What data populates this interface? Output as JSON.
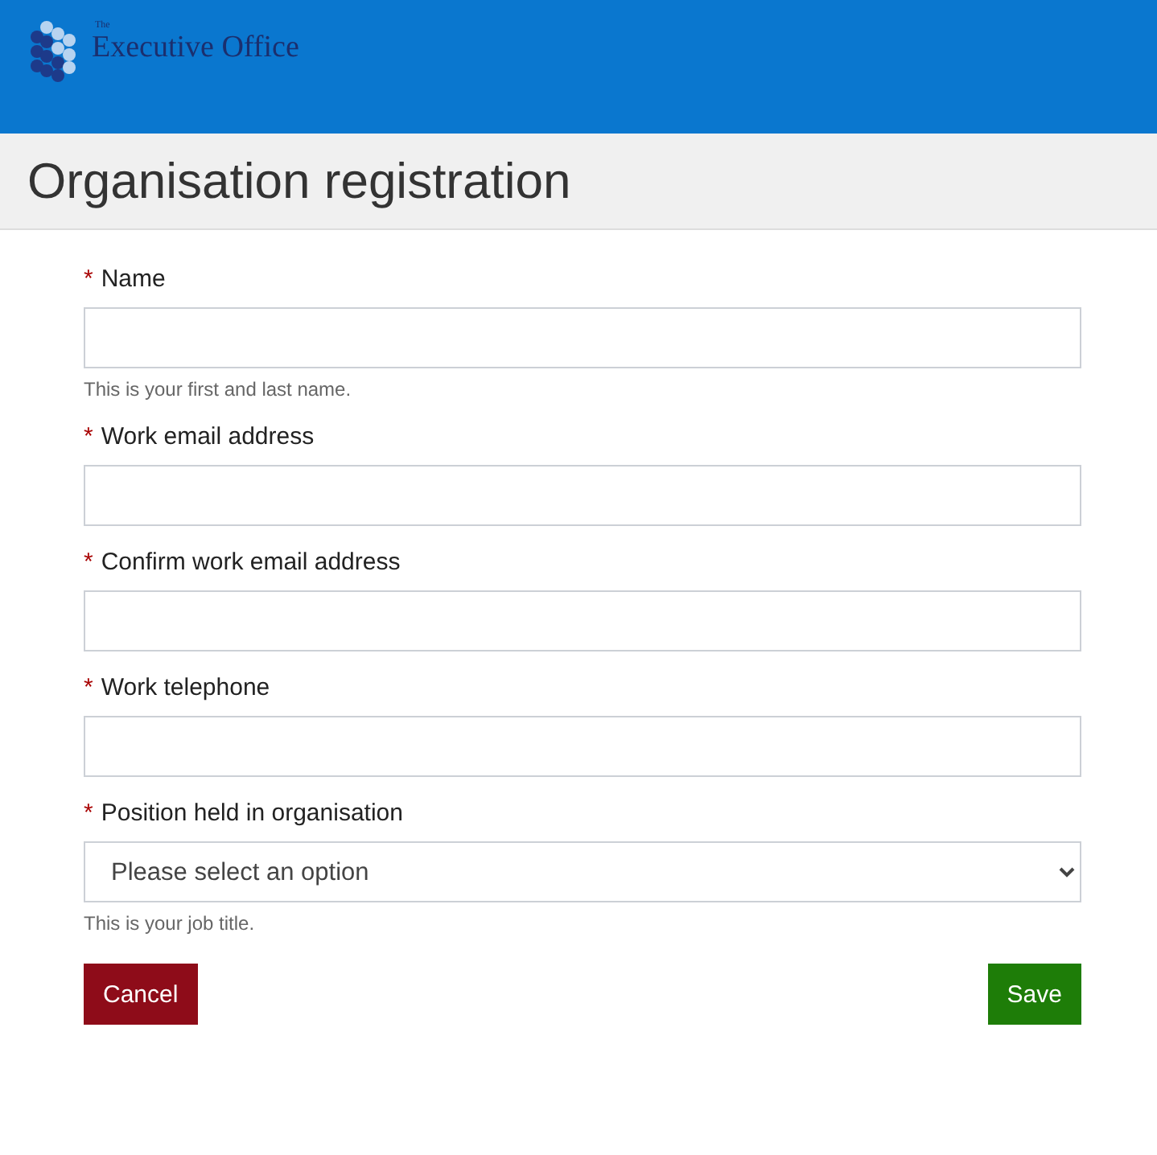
{
  "header": {
    "logo": {
      "small_text": "The",
      "name": "Executive Office"
    }
  },
  "page_title": "Organisation registration",
  "fields": [
    {
      "kind": "text",
      "required_mark": "*",
      "label": "Name",
      "hint": "This is your first and last name."
    },
    {
      "kind": "text",
      "required_mark": "*",
      "label": "Work email address"
    },
    {
      "kind": "text",
      "required_mark": "*",
      "label": "Confirm work email address"
    },
    {
      "kind": "text",
      "required_mark": "*",
      "label": "Work telephone"
    },
    {
      "kind": "select",
      "required_mark": "*",
      "label": "Position held in organisation",
      "value": "Please select an option",
      "hint": "This is your job title."
    }
  ],
  "buttons": [
    {
      "kind": "cancel",
      "label": "Cancel"
    },
    {
      "kind": "save",
      "label": "Save"
    }
  ]
}
